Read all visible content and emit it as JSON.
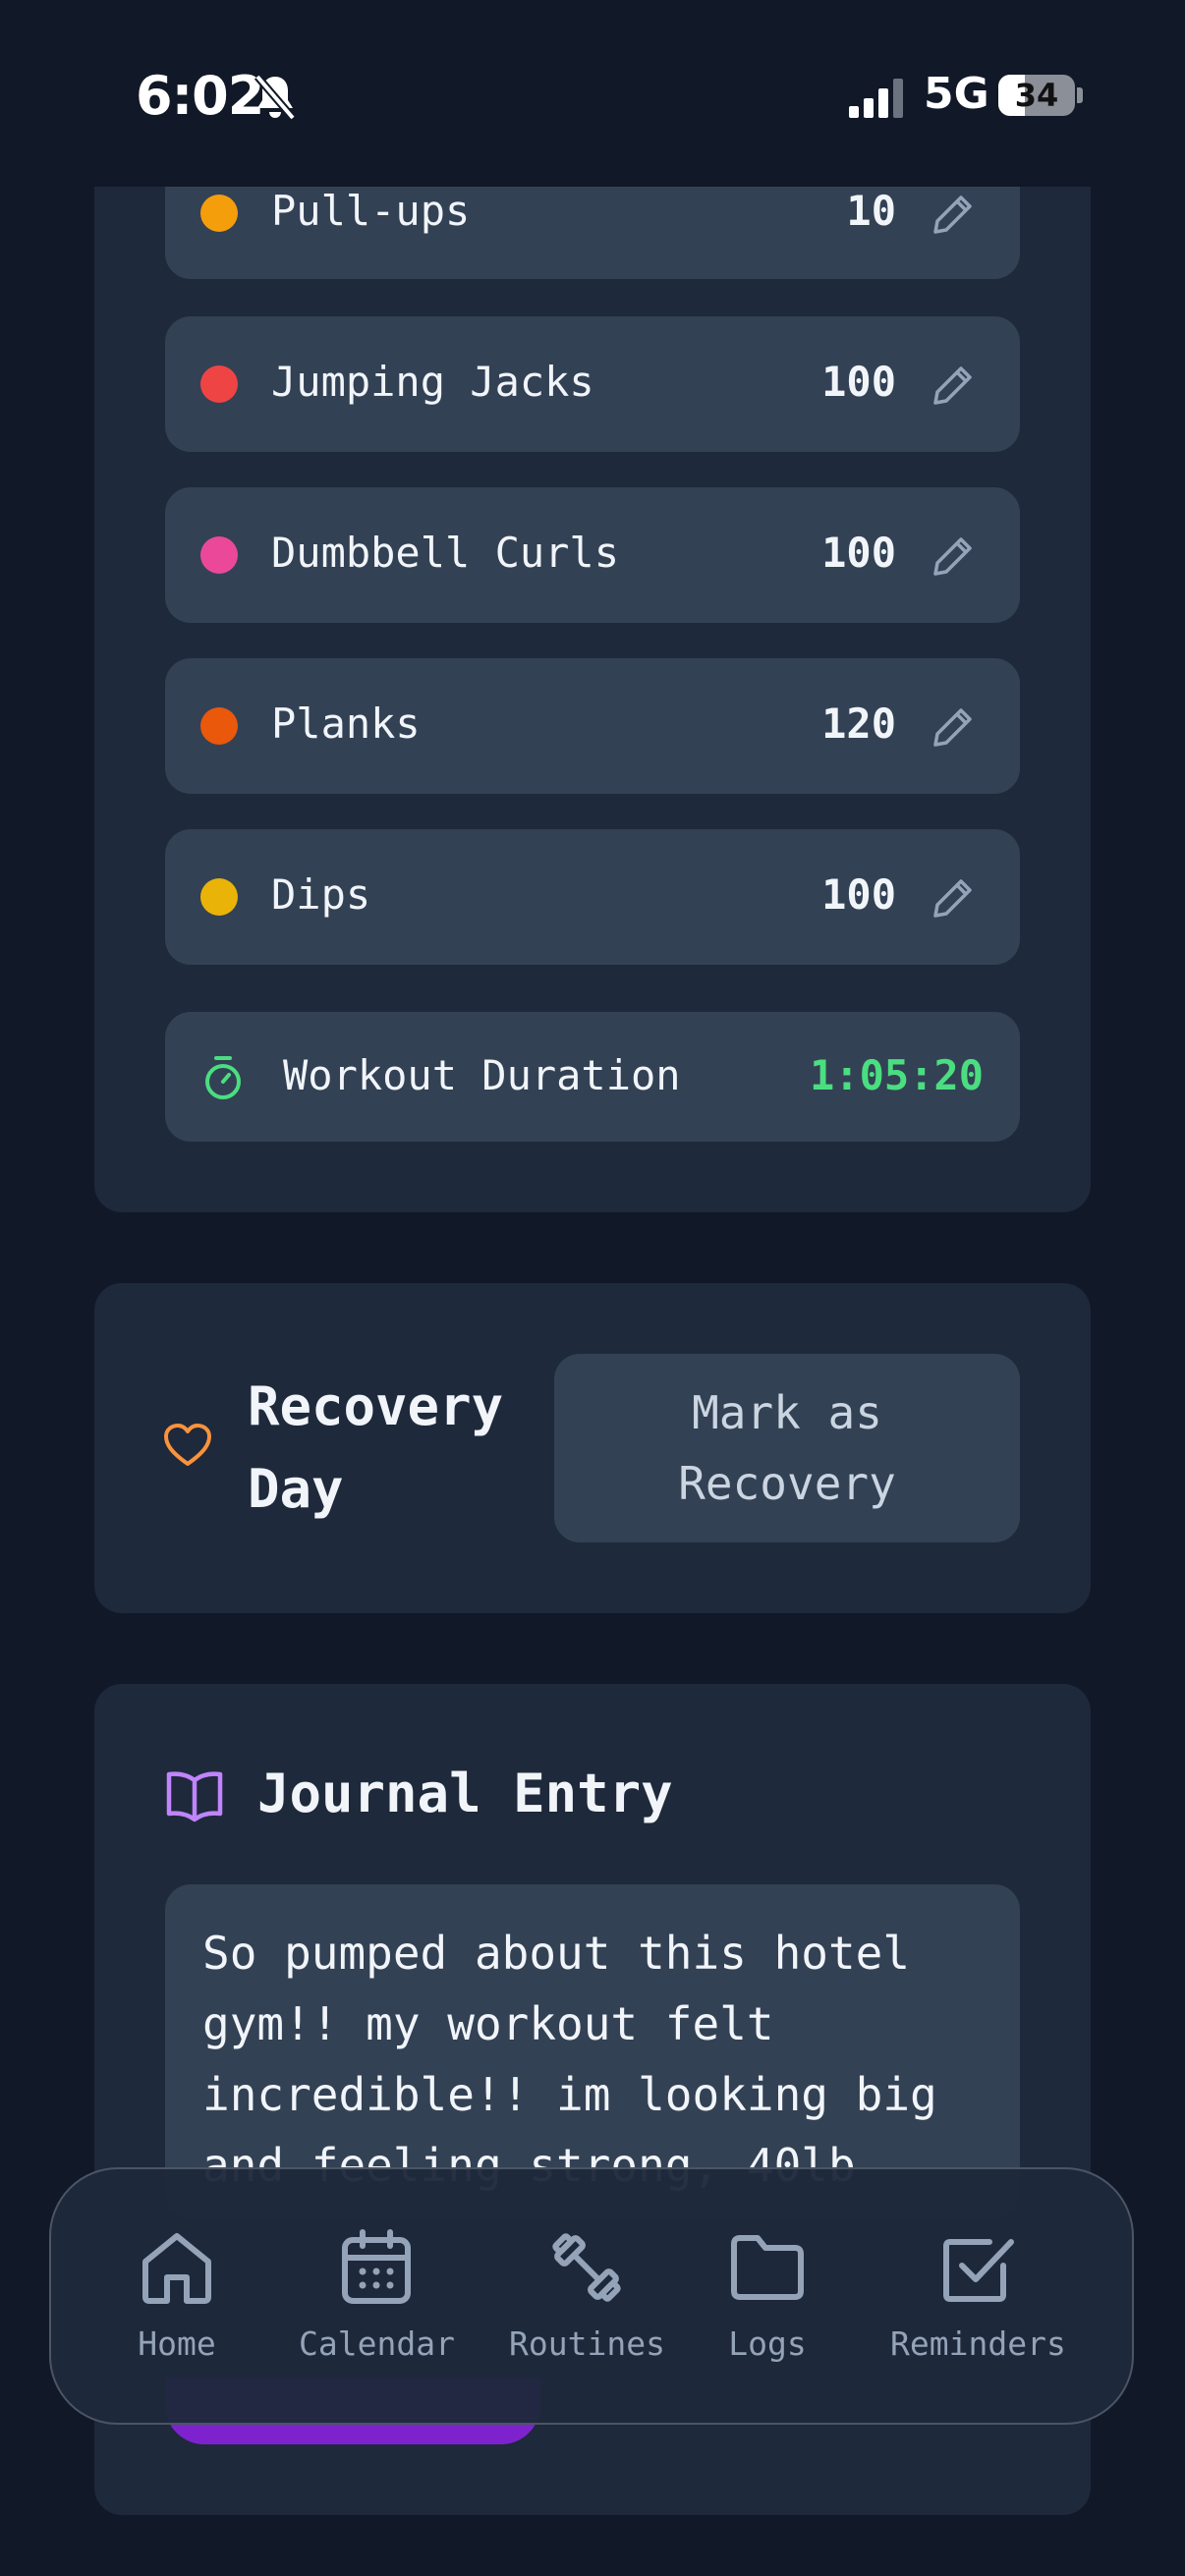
{
  "status_bar": {
    "time": "6:02",
    "network": "5G",
    "battery": "34",
    "battery_level": 0.34
  },
  "exercises": [
    {
      "name": "Pull-ups",
      "count": "10",
      "color": "#f59e0b"
    },
    {
      "name": "Jumping Jacks",
      "count": "100",
      "color": "#ef4444"
    },
    {
      "name": "Dumbbell Curls",
      "count": "100",
      "color": "#ec4899"
    },
    {
      "name": "Planks",
      "count": "120",
      "color": "#ea580c"
    },
    {
      "name": "Dips",
      "count": "100",
      "color": "#eab308"
    }
  ],
  "duration": {
    "label": "Workout Duration",
    "value": "1:05:20"
  },
  "recovery": {
    "title": "Recovery Day",
    "button": "Mark as Recovery"
  },
  "journal": {
    "title": "Journal Entry",
    "text": "So pumped about this hotel gym!! my workout felt incredible!! im looking big and feeling strong, 40lb"
  },
  "nav": [
    {
      "label": "Home",
      "icon": "home-icon"
    },
    {
      "label": "Calendar",
      "icon": "calendar-icon"
    },
    {
      "label": "Routines",
      "icon": "dumbbell-icon"
    },
    {
      "label": "Logs",
      "icon": "folder-icon"
    },
    {
      "label": "Reminders",
      "icon": "checkbox-icon"
    }
  ],
  "colors": {
    "accent_green": "#4ade80",
    "accent_purple": "#c084fc",
    "accent_orange": "#fb923c"
  }
}
